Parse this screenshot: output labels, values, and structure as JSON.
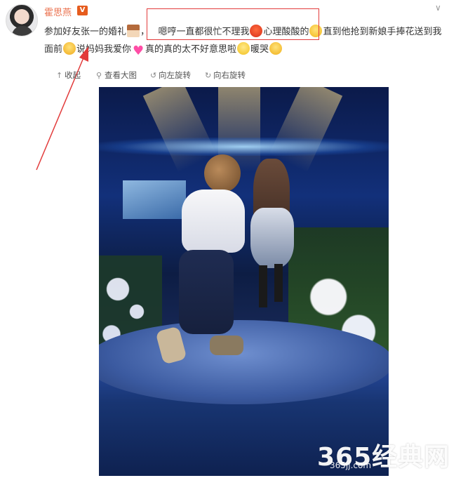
{
  "post": {
    "username": "霍思燕",
    "verified_badge": "V",
    "more_icon": "chevron-down-icon",
    "text_segments": [
      "参加好友张一的婚礼",
      "，",
      "嗯哼一直都很忙不理我",
      "心理酸酸的",
      "直到他抢到新娘手捧花送到我面前",
      "说妈妈我爱你",
      "真的真的太不好意思啦",
      "暖哭"
    ]
  },
  "toolbar": {
    "collapse": "收起",
    "view_large": "查看大图",
    "rotate_left": "向左旋转",
    "rotate_right": "向右旋转"
  },
  "watermark": {
    "main": "365经典网",
    "sub": "365jj.com"
  },
  "colors": {
    "username": "#eb7350",
    "highlight_box": "#e23b3b",
    "arrow": "#e23b3b"
  }
}
